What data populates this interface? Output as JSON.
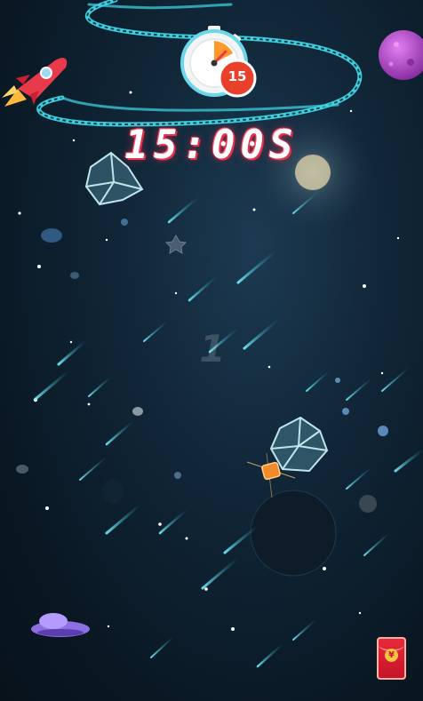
{
  "game": {
    "countdown": "15:00S",
    "stopwatch_badge": "15",
    "round_number": "1"
  },
  "red_packet": {
    "symbol": "¥"
  },
  "colors": {
    "background": "#0e2030",
    "track": "#3fd8e8",
    "timer_red": "#e0304a",
    "planet_purple": "#b64fc8",
    "meteor": "#4fe0f0"
  },
  "icons": [
    "rocket-icon",
    "stopwatch-icon",
    "planet-icon",
    "ufo-icon",
    "red-packet-icon",
    "web-star-icon",
    "satellite-icon"
  ]
}
